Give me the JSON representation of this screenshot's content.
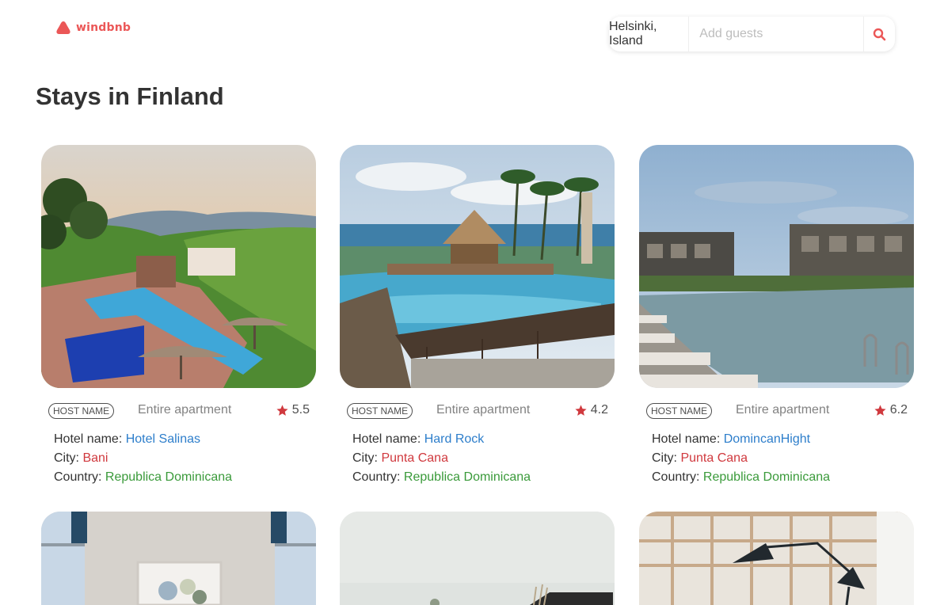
{
  "logo": {
    "text": "windbnb"
  },
  "search": {
    "location": "Helsinki, Island",
    "guests_placeholder": "Add guests"
  },
  "page_title": "Stays in Finland",
  "labels": {
    "hotel": "Hotel name: ",
    "city": "City: ",
    "country": "Country: "
  },
  "colors": {
    "brand": "#eb5757",
    "name": "#2d7ecb",
    "city": "#d0393e",
    "country": "#3a9a3a",
    "star": "#eb5757"
  },
  "stays": [
    {
      "host": "HOST NAME",
      "type": "Entire apartment",
      "rating": "5.5",
      "name": "Hotel Salinas",
      "city": "Bani",
      "country": "Republica Dominicana"
    },
    {
      "host": "HOST NAME",
      "type": "Entire apartment",
      "rating": "4.2",
      "name": "Hard Rock",
      "city": "Punta Cana",
      "country": "Republica Dominicana"
    },
    {
      "host": "HOST NAME",
      "type": "Entire apartment",
      "rating": "6.2",
      "name": "DomincanHight",
      "city": "Punta Cana",
      "country": "Republica Dominicana"
    }
  ]
}
